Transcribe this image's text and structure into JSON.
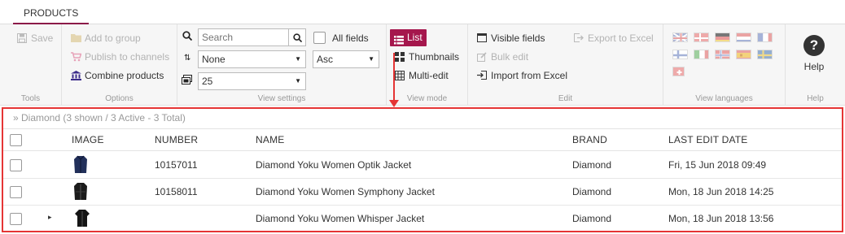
{
  "tabs": {
    "products": "PRODUCTS"
  },
  "tools": {
    "title": "Tools",
    "save": "Save"
  },
  "options": {
    "title": "Options",
    "add_to_group": "Add to group",
    "publish": "Publish to channels",
    "combine": "Combine products"
  },
  "view_settings": {
    "title": "View settings",
    "search_placeholder": "Search",
    "all_fields": "All fields",
    "sort_field": "None",
    "sort_dir": "Asc",
    "page_size": "25"
  },
  "view_mode": {
    "title": "View mode",
    "list": "List",
    "thumbnails": "Thumbnails",
    "multi_edit": "Multi-edit"
  },
  "edit": {
    "title": "Edit",
    "visible_fields": "Visible fields",
    "export_excel": "Export to Excel",
    "bulk_edit": "Bulk edit",
    "import_excel": "Import from Excel"
  },
  "languages": {
    "title": "View languages",
    "flags": [
      "gb",
      "dk",
      "de",
      "nl",
      "fr",
      "fi",
      "it",
      "no",
      "es",
      "se",
      "ch"
    ]
  },
  "help": {
    "title": "Help",
    "label": "Help",
    "glyph": "?"
  },
  "accent_color": "#a5174d",
  "highlight_color": "#e53535",
  "breadcrumb": "» Diamond (3 shown / 3 Active - 3 Total)",
  "columns": {
    "image": "IMAGE",
    "number": "NUMBER",
    "name": "NAME",
    "brand": "BRAND",
    "last_edit": "LAST EDIT DATE"
  },
  "rows": [
    {
      "number": "10157011",
      "name": "Diamond Yoku Women Optik Jacket",
      "brand": "Diamond",
      "date": "Fri, 15 Jun 2018 09:49"
    },
    {
      "number": "10158011",
      "name": "Diamond Yoku Women Symphony Jacket",
      "brand": "Diamond",
      "date": "Mon, 18 Jun 2018 14:25"
    },
    {
      "number": "",
      "name": "Diamond Yoku Women Whisper Jacket",
      "brand": "Diamond",
      "date": "Mon, 18 Jun 2018 13:56"
    }
  ]
}
